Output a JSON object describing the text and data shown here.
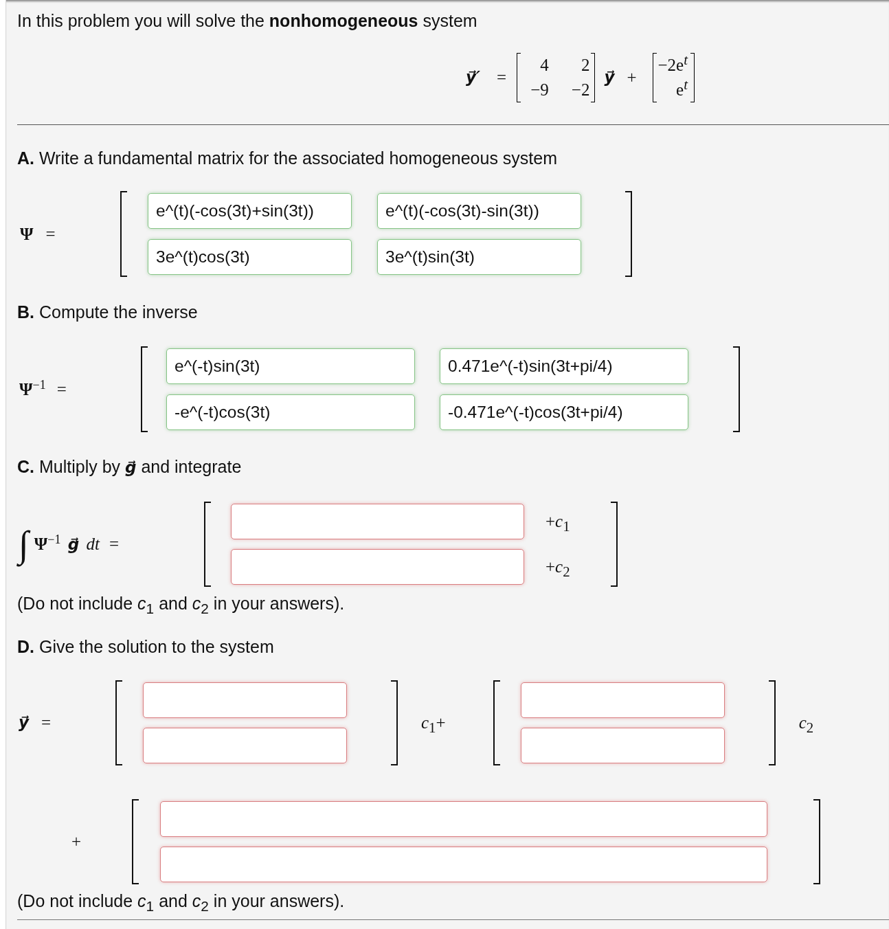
{
  "intro": "In this problem you will solve the **nonhomogeneous** system",
  "system": {
    "lhs": "y⃗′",
    "equals": "=",
    "matrix": [
      [
        "4",
        "2"
      ],
      [
        "−9",
        "−2"
      ]
    ],
    "vector": "y⃗",
    "plus": "+",
    "forcing": [
      "−2e$^{t}$",
      "e$^{t}$"
    ]
  },
  "part_a": {
    "heading": "**A.** Write a fundamental matrix for the associated homogeneous system",
    "lhs": "Ψ",
    "equals": "=",
    "fields": [
      [
        {
          "value": "e^(t)(-cos(3t)+sin(3t))",
          "correct": true
        },
        {
          "value": "e^(t)(-cos(3t)-sin(3t))",
          "correct": true
        }
      ],
      [
        {
          "value": "3e^(t)cos(3t)",
          "correct": true
        },
        {
          "value": "3e^(t)sin(3t)",
          "correct": true
        }
      ]
    ]
  },
  "part_b": {
    "heading": "**B.** Compute the inverse",
    "lhs": "**Ψ**$^{−1}$",
    "equals": "=",
    "fields": [
      [
        {
          "value": "e^(-t)sin(3t)",
          "correct": true
        },
        {
          "value": "0.471e^(-t)sin(3t+pi/4)",
          "correct": true
        }
      ],
      [
        {
          "value": "-e^(-t)cos(3t)",
          "correct": true
        },
        {
          "value": "-0.471e^(-t)cos(3t+pi/4)",
          "correct": true
        }
      ]
    ]
  },
  "part_c": {
    "heading": "**C.** Multiply by **g⃗** and integrate",
    "integral": "∫",
    "lhs": "**Ψ**$^{−1}$ **g⃗** *dt*",
    "equals": "=",
    "rows": [
      {
        "field": {
          "correct": false
        },
        "suffix": "+*c*$_{1}$"
      },
      {
        "field": {
          "correct": false
        },
        "suffix": "+*c*$_{2}$"
      }
    ],
    "note": "(Do not include *c*$_{1}$ and *c*$_{2}$ in your answers)."
  },
  "part_d": {
    "heading": "**D.** Give the solution to the system",
    "lhs": "y⃗",
    "equals": "=",
    "terms": [
      {
        "fields": [
          {
            "correct": false
          },
          {
            "correct": false
          }
        ],
        "coefficient": "*c*$_{1}$+"
      },
      {
        "fields": [
          {
            "correct": false
          },
          {
            "correct": false
          }
        ],
        "coefficient": "*c*$_{2}$"
      }
    ],
    "particular": {
      "plus": "+",
      "fields": [
        {
          "correct": false
        },
        {
          "correct": false
        }
      ]
    },
    "note": "(Do not include *c*$_{1}$ and *c*$_{2}$ in your answers)."
  }
}
